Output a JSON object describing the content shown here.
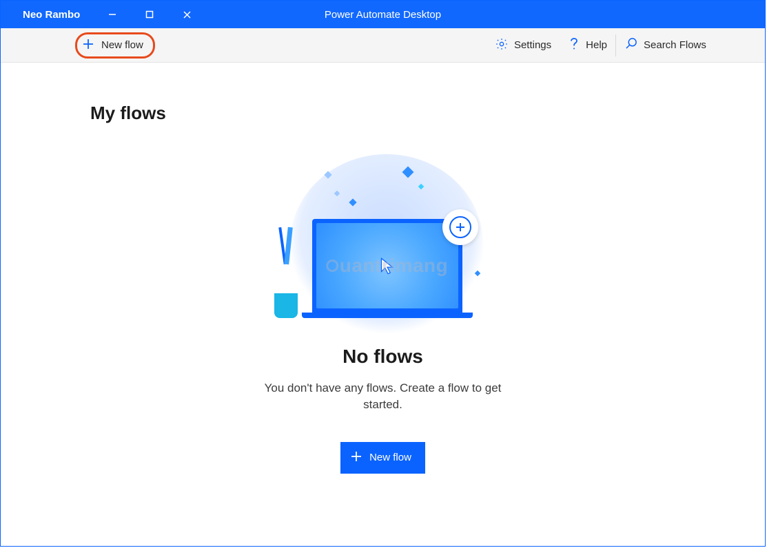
{
  "titlebar": {
    "app_title": "Power Automate Desktop",
    "user_name": "Neo Rambo"
  },
  "toolbar": {
    "new_flow_label": "New flow",
    "settings_label": "Settings",
    "help_label": "Help",
    "search_placeholder": "Search Flows"
  },
  "page": {
    "title": "My flows"
  },
  "empty_state": {
    "title": "No flows",
    "subtitle": "You don't have any flows. Create a flow to get started.",
    "button_label": "New flow"
  },
  "watermark": {
    "text": "uantrimang"
  }
}
